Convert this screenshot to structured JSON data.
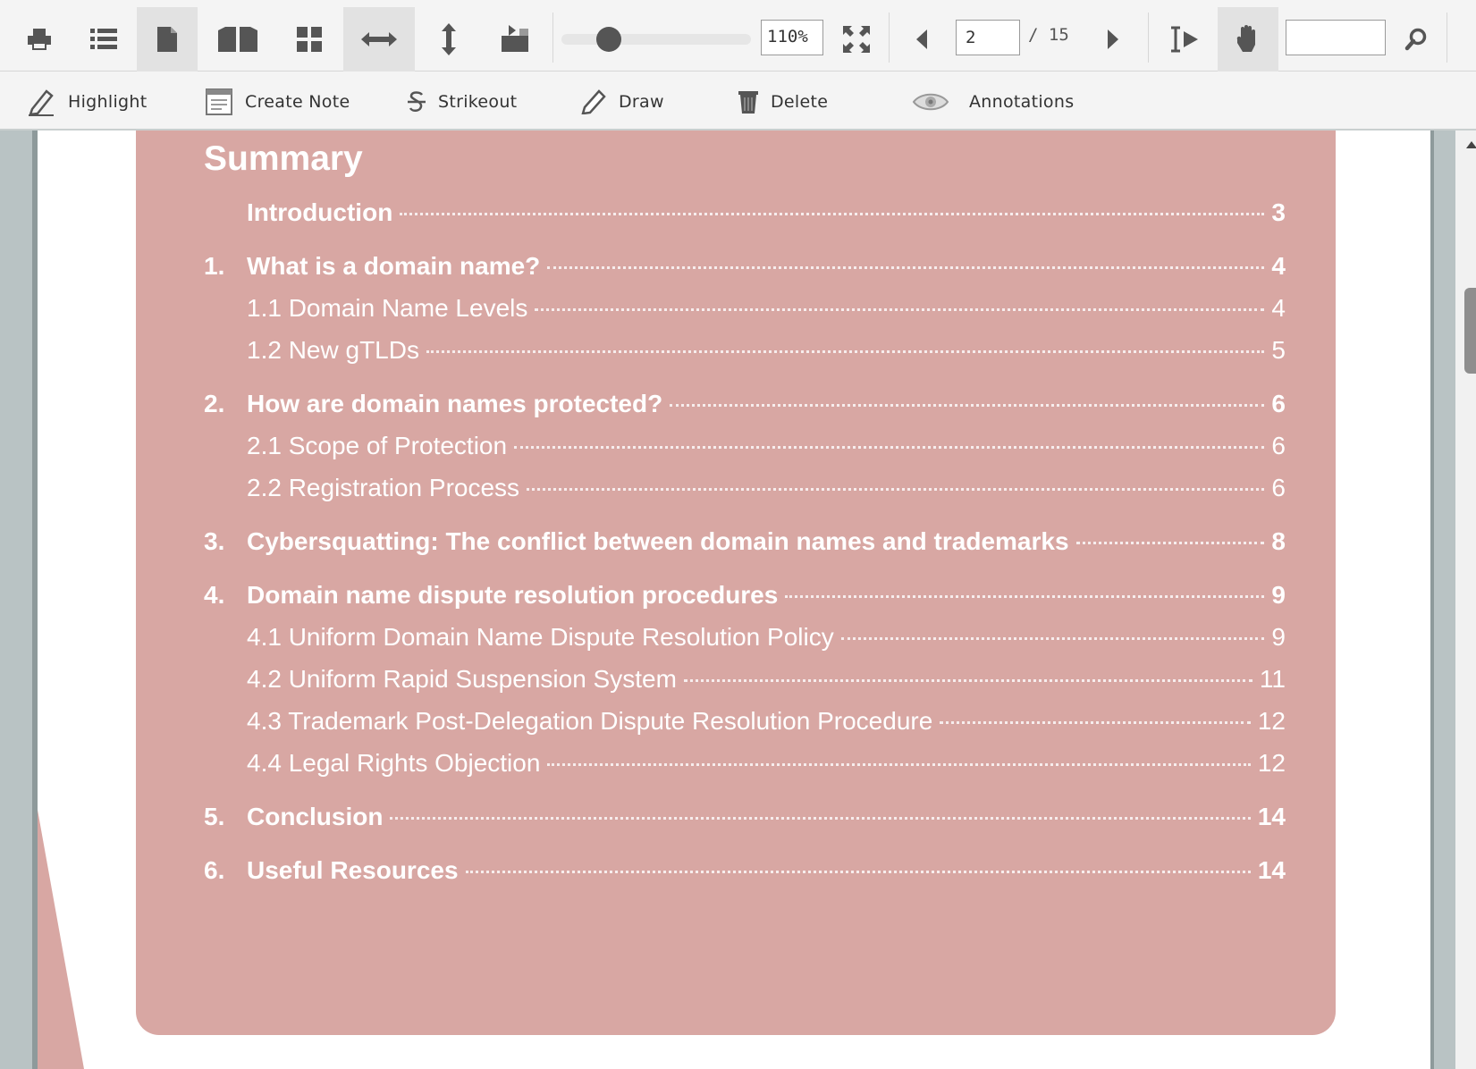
{
  "toolbar": {
    "zoom": "110%",
    "zoom_level": 0.25,
    "page_current": "2",
    "page_total": "/ 15",
    "search_value": "",
    "icons": {
      "print": "print-icon",
      "outline": "outline-list-icon",
      "single_page": "single-page-icon",
      "facing_pages": "facing-pages-icon",
      "thumbnails": "thumbnails-grid-icon",
      "fit_width": "fit-width-icon",
      "fit_height": "fit-height-icon",
      "rotate": "rotate-page-icon",
      "fullscreen": "fullscreen-icon",
      "prev": "prev-page-icon",
      "next": "next-page-icon",
      "text_select": "text-select-icon",
      "pan": "pan-hand-icon",
      "search": "search-icon"
    }
  },
  "annotations_bar": {
    "highlight": "Highlight",
    "create_note": "Create Note",
    "strikeout": "Strikeout",
    "draw": "Draw",
    "delete": "Delete",
    "annotations": "Annotations"
  },
  "document": {
    "accent_color": "#d8a7a3",
    "title": "Summary",
    "toc": [
      {
        "num": "",
        "text": "Introduction",
        "page": "3",
        "level": 1
      },
      {
        "num": "1.",
        "text": "What is a domain name?",
        "page": "4",
        "level": 1
      },
      {
        "num": "",
        "text": "1.1 Domain Name Levels",
        "page": "4",
        "level": 2
      },
      {
        "num": "",
        "text": "1.2 New gTLDs",
        "page": "5",
        "level": 2
      },
      {
        "num": "2.",
        "text": "How are domain names protected?",
        "page": "6",
        "level": 1
      },
      {
        "num": "",
        "text": "2.1 Scope of Protection",
        "page": "6",
        "level": 2
      },
      {
        "num": "",
        "text": "2.2 Registration Process",
        "page": "6",
        "level": 2
      },
      {
        "num": "3.",
        "text": "Cybersquatting: The conflict between domain names and trademarks",
        "page": "8",
        "level": 1
      },
      {
        "num": "4.",
        "text": "Domain name dispute resolution procedures",
        "page": "9",
        "level": 1
      },
      {
        "num": "",
        "text": "4.1 Uniform Domain Name Dispute Resolution Policy",
        "page": "9",
        "level": 2
      },
      {
        "num": "",
        "text": "4.2 Uniform Rapid Suspension System",
        "page": "11",
        "level": 2
      },
      {
        "num": "",
        "text": "4.3 Trademark Post-Delegation Dispute Resolution Procedure",
        "page": "12",
        "level": 2
      },
      {
        "num": "",
        "text": "4.4 Legal Rights Objection",
        "page": "12",
        "level": 2
      },
      {
        "num": "5.",
        "text": "Conclusion",
        "page": "14",
        "level": 1
      },
      {
        "num": "6.",
        "text": "Useful Resources",
        "page": "14",
        "level": 1
      }
    ]
  }
}
